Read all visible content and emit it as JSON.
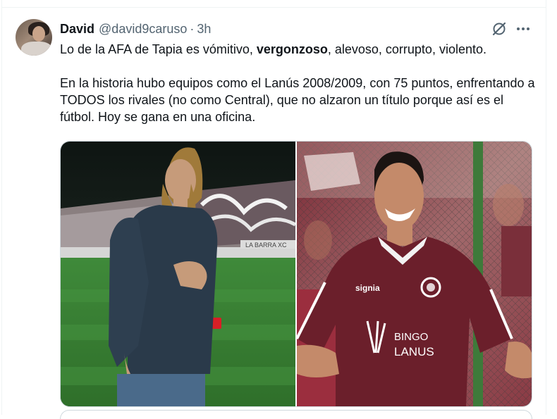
{
  "tweet": {
    "author_name": "David",
    "author_handle": "@david9caruso",
    "separator": "·",
    "time": "3h",
    "line1_part1": "Lo de la AFA de Tapia es vómitivo, ",
    "line1_bold": "vergonzoso",
    "line1_part2": ", alevoso, corrupto, violento.",
    "paragraph2": "En la historia hubo equipos como el Lanús 2008/2009, con 75 puntos, enfrentando a TODOS los rivales (no como Central), que no alzaron un título porque así es el fútbol. Hoy se gana en una oficina."
  },
  "images": {
    "right_jersey_sponsor": "signia",
    "right_jersey_brand_line1": "BINGO",
    "right_jersey_brand_line2": "LANUS",
    "left_stadium_banner": "LA BARRA XC"
  },
  "icons": {
    "grok": "grok-icon",
    "more": "more-options-icon"
  },
  "colors": {
    "text_primary": "#0f1419",
    "text_secondary": "#536471",
    "border": "#cfd9de",
    "jersey": "#6b1f2b"
  }
}
